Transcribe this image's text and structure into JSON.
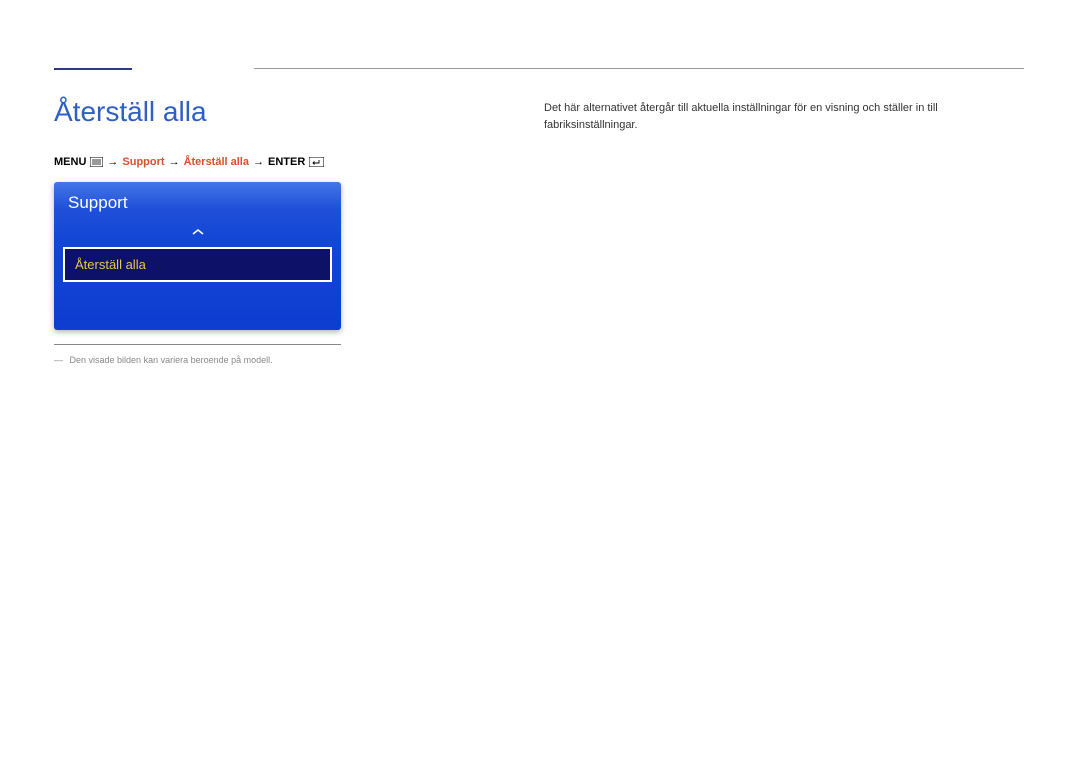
{
  "page_title": "Återställ alla",
  "breadcrumb": {
    "menu_label": "MENU",
    "arrow": "→",
    "path1": "Support",
    "path2": "Återställ alla",
    "enter_label": "ENTER"
  },
  "osd": {
    "header": "Support",
    "selected_item": "Återställ alla"
  },
  "footnote": {
    "dash": "―",
    "text": "Den visade bilden kan variera beroende på modell."
  },
  "description": "Det här alternativet återgår till aktuella inställningar för en visning och ställer in till fabriksinställningar."
}
